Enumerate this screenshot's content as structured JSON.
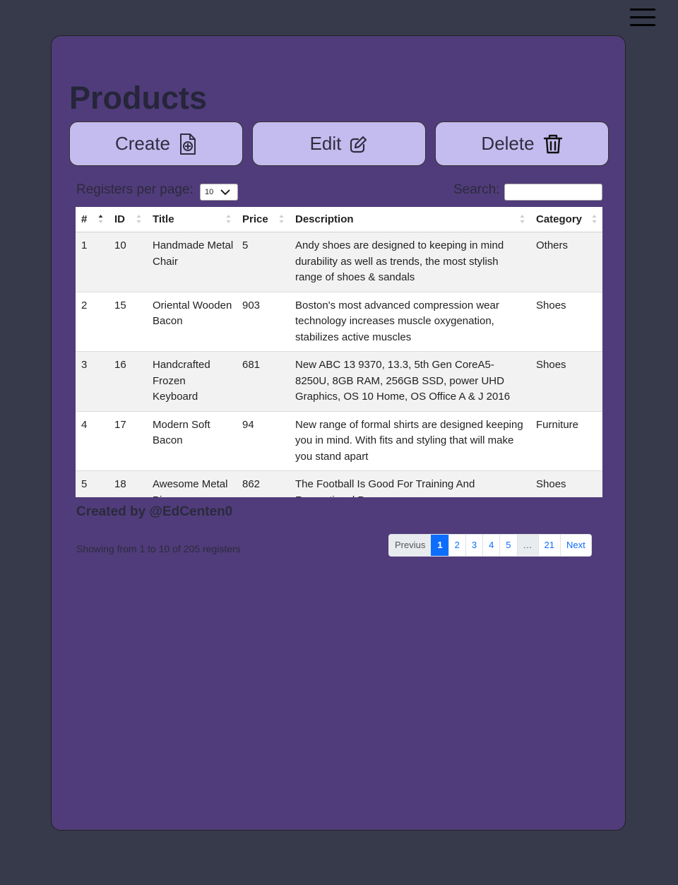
{
  "header": {
    "menu_icon": "hamburger-menu-icon"
  },
  "page": {
    "title": "Products"
  },
  "toolbar": {
    "create_label": "Create",
    "edit_label": "Edit",
    "delete_label": "Delete"
  },
  "controls": {
    "rpp_label": "Registers per page:",
    "rpp_value": "10",
    "search_label": "Search:",
    "search_value": ""
  },
  "table": {
    "columns": [
      "#",
      "ID",
      "Title",
      "Price",
      "Description",
      "Category"
    ],
    "rows": [
      [
        "1",
        "10",
        "Handmade Metal Chair",
        "5",
        "Andy shoes are designed to keeping in mind durability as well as trends, the most stylish range of shoes & sandals",
        "Others"
      ],
      [
        "2",
        "15",
        "Oriental Wooden Bacon",
        "903",
        "Boston's most advanced compression wear technology increases muscle oxygenation, stabilizes active muscles",
        "Shoes"
      ],
      [
        "3",
        "16",
        "Handcrafted Frozen Keyboard",
        "681",
        "New ABC 13 9370, 13.3, 5th Gen CoreA5-8250U, 8GB RAM, 256GB SSD, power UHD Graphics, OS 10 Home, OS Office A & J 2016",
        "Shoes"
      ],
      [
        "4",
        "17",
        "Modern Soft Bacon",
        "94",
        "New range of formal shirts are designed keeping you in mind. With fits and styling that will make you stand apart",
        "Furniture"
      ],
      [
        "5",
        "18",
        "Awesome Metal Pizza",
        "862",
        "The Football Is Good For Training And Recreational Purposes",
        "Shoes"
      ]
    ]
  },
  "footer": {
    "credit": "Created by @EdCenten0",
    "info": "Showing from 1 to 10 of 205 registers"
  },
  "pagination": {
    "previous": "Previus",
    "pages": [
      "1",
      "2",
      "3",
      "4",
      "5",
      "…",
      "21"
    ],
    "next": "Next",
    "active": "1"
  },
  "colors": {
    "background": "#363a4b",
    "card": "#503c7a",
    "button": "#c4bcee",
    "accent": "#0d6efd"
  }
}
